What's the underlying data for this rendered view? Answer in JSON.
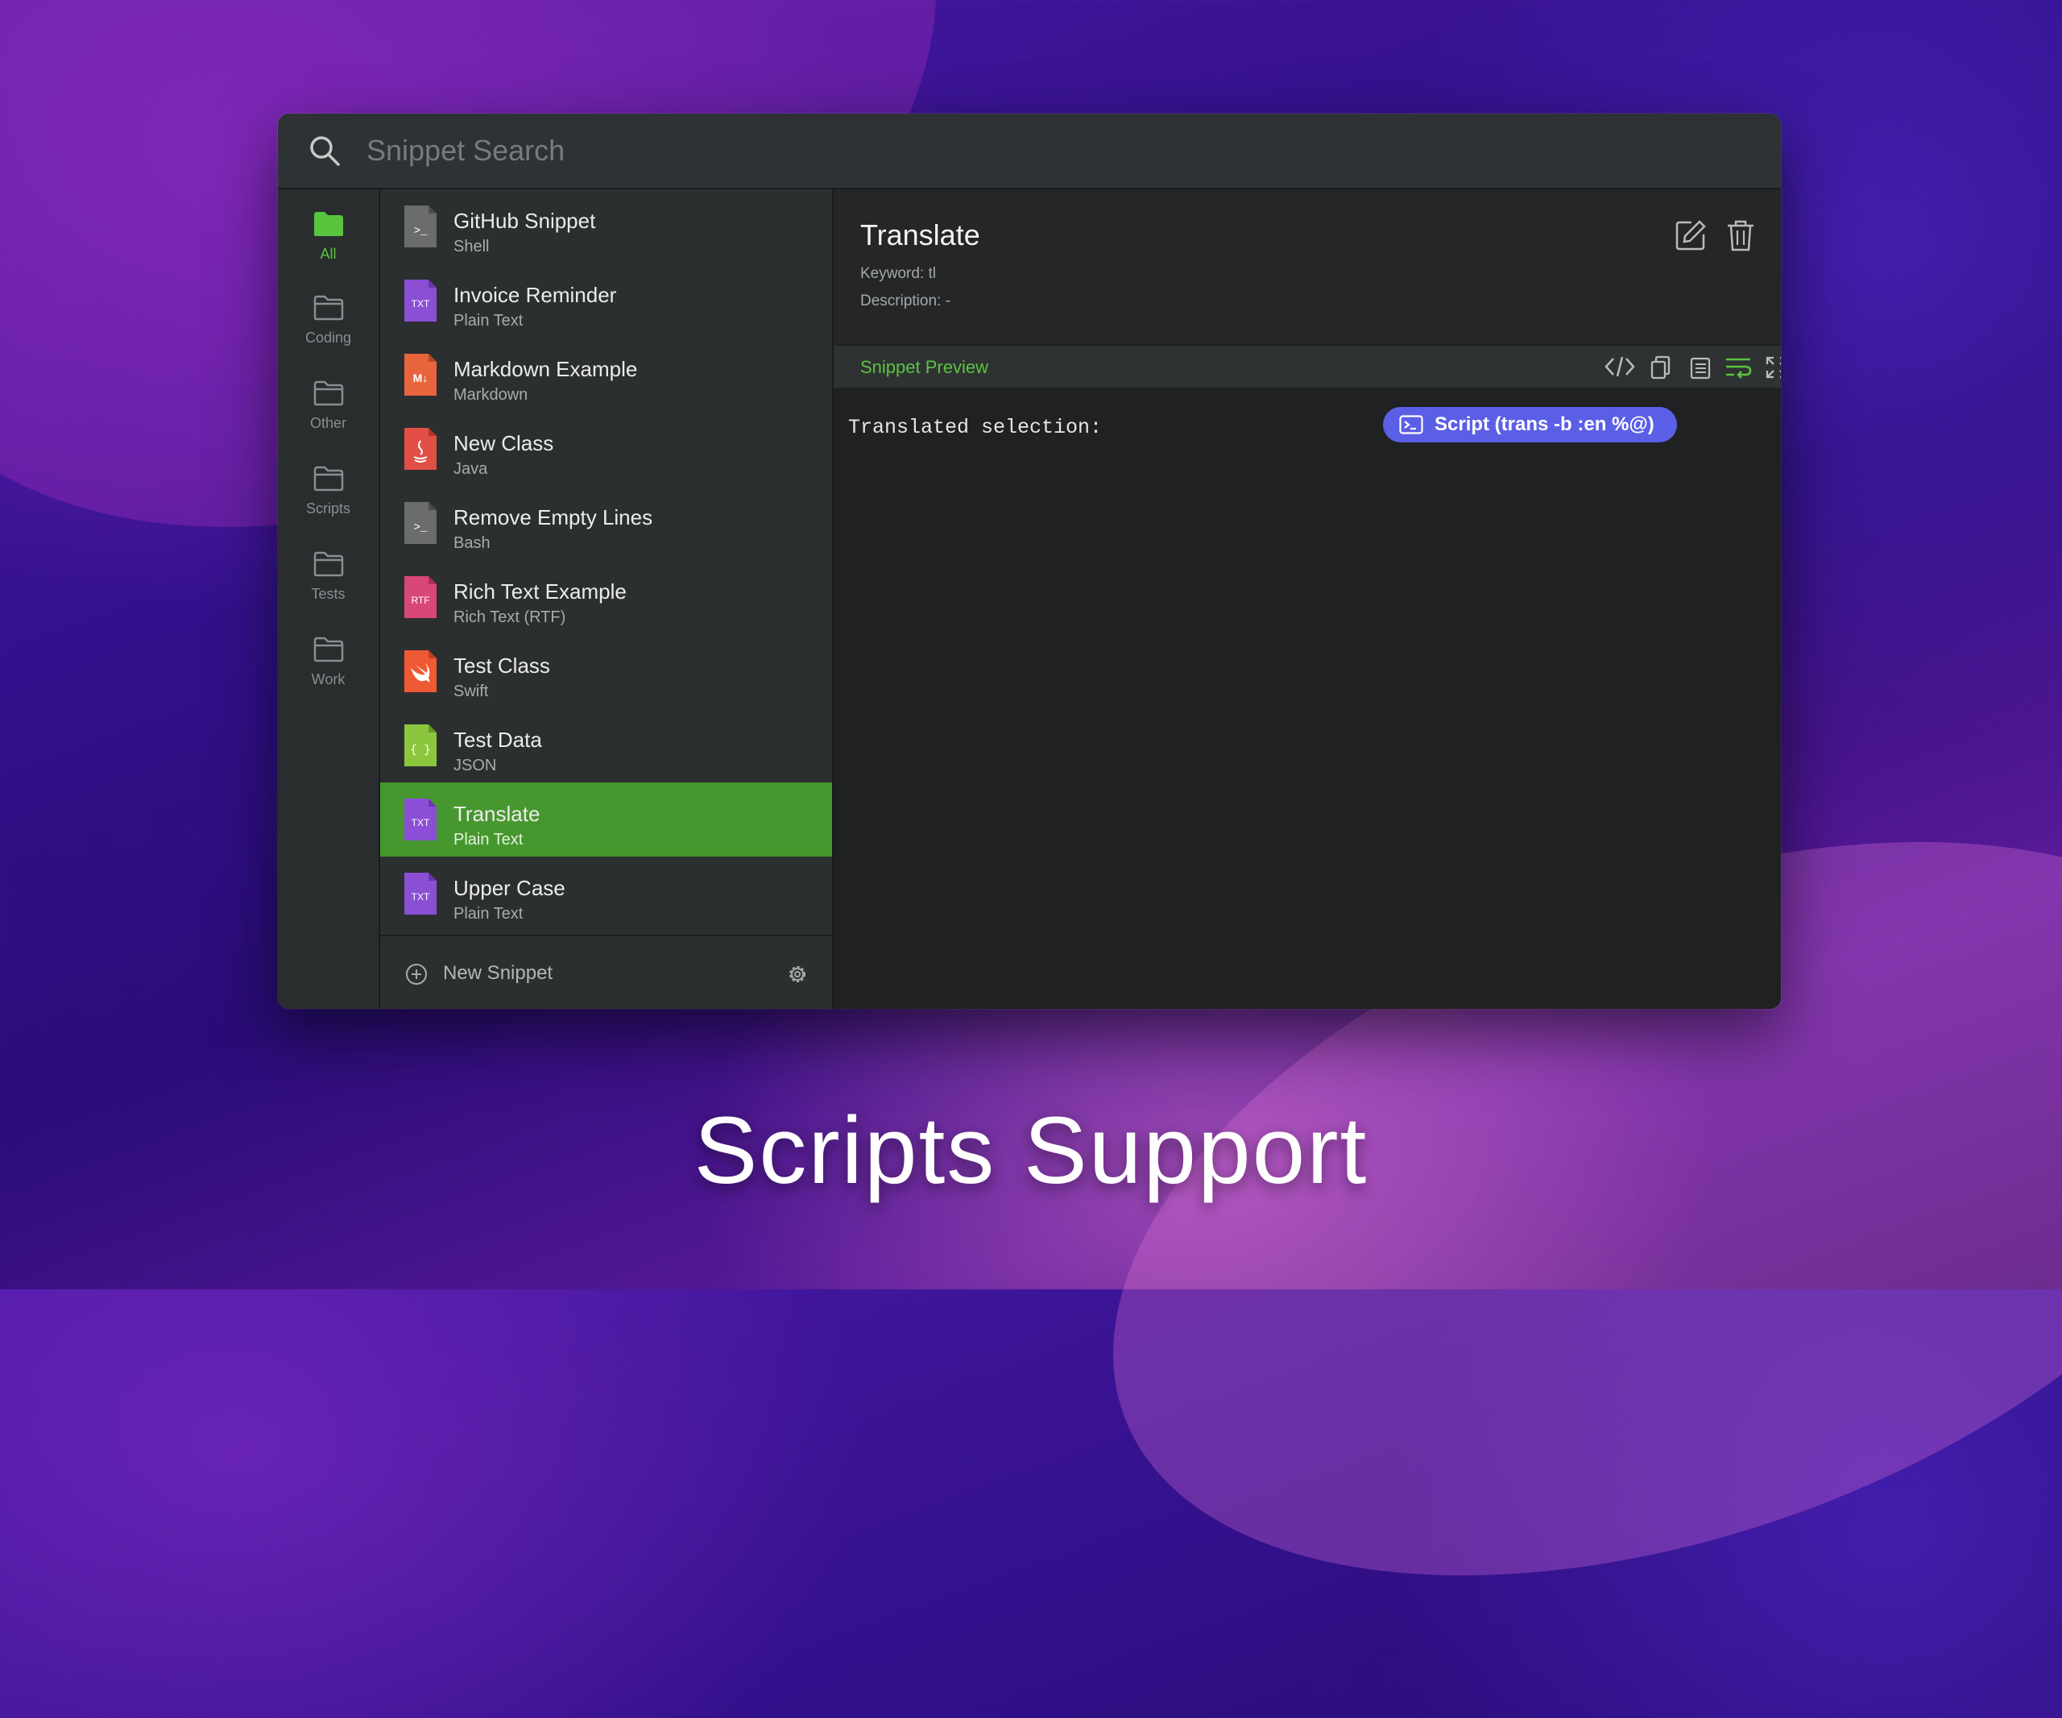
{
  "search": {
    "placeholder": "Snippet Search"
  },
  "folders": [
    {
      "label": "All",
      "active": true
    },
    {
      "label": "Coding"
    },
    {
      "label": "Other"
    },
    {
      "label": "Scripts"
    },
    {
      "label": "Tests"
    },
    {
      "label": "Work"
    }
  ],
  "snippets": [
    {
      "title": "GitHub Snippet",
      "type": "Shell",
      "icon": "shell-file-icon"
    },
    {
      "title": "Invoice Reminder",
      "type": "Plain Text",
      "icon": "txt-file-icon"
    },
    {
      "title": "Markdown Example",
      "type": "Markdown",
      "icon": "markdown-file-icon"
    },
    {
      "title": "New Class",
      "type": "Java",
      "icon": "java-file-icon"
    },
    {
      "title": "Remove Empty Lines",
      "type": "Bash",
      "icon": "shell-file-icon"
    },
    {
      "title": "Rich Text Example",
      "type": "Rich Text (RTF)",
      "icon": "rtf-file-icon"
    },
    {
      "title": "Test Class",
      "type": "Swift",
      "icon": "swift-file-icon"
    },
    {
      "title": "Test Data",
      "type": "JSON",
      "icon": "json-file-icon"
    },
    {
      "title": "Translate",
      "type": "Plain Text",
      "icon": "txt-file-icon",
      "selected": true
    },
    {
      "title": "Upper Case",
      "type": "Plain Text",
      "icon": "txt-file-icon"
    }
  ],
  "footer": {
    "new_snippet_label": "New Snippet"
  },
  "detail": {
    "title": "Translate",
    "keyword": "Keyword: tl",
    "description": "Description: -",
    "preview_label": "Snippet Preview",
    "preview_text": "Translated selection:",
    "script_pill": "Script (trans -b :en %@)"
  },
  "icon_glyphs": {
    "txt": "TXT",
    "rtf": "RTF",
    "json": "{ }",
    "shell": ">_",
    "markdown": "M↓"
  },
  "caption": "Scripts Support",
  "colors": {
    "accent_green": "#59c43e",
    "selected_row": "#46982e",
    "script_pill": "#5b5fe6",
    "txt_icon": "#8b4fd6",
    "markdown_icon": "#e8643c",
    "java_icon": "#e14f45",
    "shell_icon": "#6a6c6e",
    "rtf_icon": "#d8467a",
    "swift_icon": "#ef5a35",
    "json_icon": "#8cc63f"
  }
}
